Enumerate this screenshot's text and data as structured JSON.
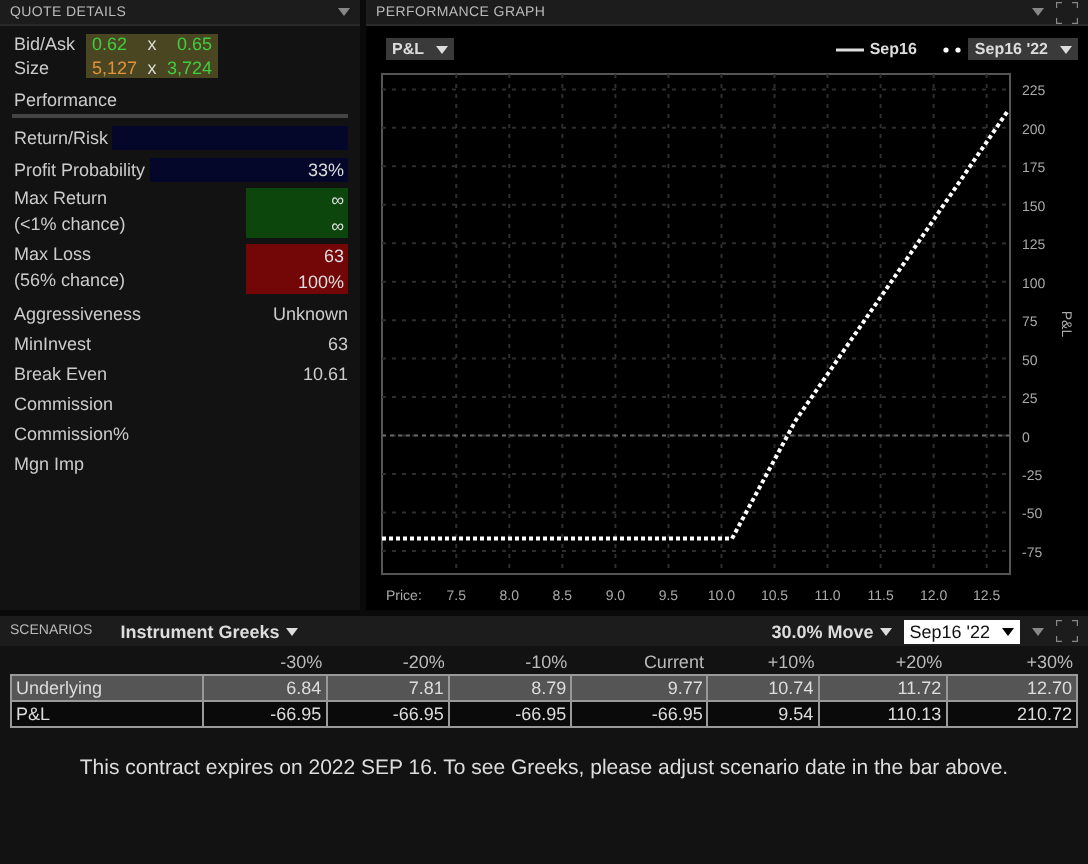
{
  "quote_details": {
    "title": "QUOTE DETAILS",
    "bid_ask": {
      "label": "Bid/Ask",
      "bid": "0.62",
      "sep": "x",
      "ask": "0.65"
    },
    "size": {
      "label": "Size",
      "bid": "5,127",
      "sep": "x",
      "ask": "3,724"
    },
    "performance_title": "Performance",
    "metrics": [
      {
        "kind": "bar",
        "label": "Return/Risk",
        "color": "#05072a"
      },
      {
        "kind": "bar",
        "label": "Profit Probability",
        "value": "33%",
        "color": "#05072a"
      },
      {
        "kind": "double",
        "label": "Max Return",
        "sublabel": "(<1% chance)",
        "value": "∞",
        "subvalue": "∞",
        "color": "#0c460c"
      },
      {
        "kind": "double",
        "label": "Max Loss",
        "sublabel": "(56% chance)",
        "value": "63",
        "subvalue": "100%",
        "color": "#730707"
      },
      {
        "kind": "plain",
        "label": "Aggressiveness",
        "value": "Unknown"
      },
      {
        "kind": "plain",
        "label": "MinInvest",
        "value": "63"
      },
      {
        "kind": "plain",
        "label": "Break Even",
        "value": "10.61"
      },
      {
        "kind": "plain",
        "label": "Commission"
      },
      {
        "kind": "plain",
        "label": "Commission%"
      },
      {
        "kind": "plain",
        "label": "Mgn Imp"
      }
    ]
  },
  "performance_graph": {
    "title": "PERFORMANCE GRAPH",
    "metric_select": "P&L",
    "legend": [
      {
        "kind": "solid",
        "label": "Sep16"
      }
    ],
    "price_label": "Price:",
    "chart_data": {
      "type": "line",
      "ylabel": "P&L",
      "x": [
        6.8,
        10.1,
        10.7,
        11.7,
        12.7
      ],
      "series": [
        {
          "name": "Sep16 '22",
          "color": "#ffffff",
          "line_style": "dotted",
          "values": [
            -67,
            -67,
            10,
            110,
            211
          ]
        }
      ],
      "xlim": [
        6.8,
        12.72
      ],
      "ylim": [
        -90,
        235
      ],
      "grid": true,
      "ref_lines": [
        {
          "axis": "y",
          "value": 0
        }
      ],
      "xticks": [
        {
          "value": 7.5,
          "label": "7.5"
        },
        {
          "value": 8,
          "label": "8.0"
        },
        {
          "value": 8.5,
          "label": "8.5"
        },
        {
          "value": 9,
          "label": "9.0"
        },
        {
          "value": 9.5,
          "label": "9.5"
        },
        {
          "value": 10,
          "label": "10.0"
        },
        {
          "value": 10.5,
          "label": "10.5"
        },
        {
          "value": 11,
          "label": "11.0"
        },
        {
          "value": 11.5,
          "label": "11.5"
        },
        {
          "value": 12,
          "label": "12.0"
        },
        {
          "value": 12.5,
          "label": "12.5"
        }
      ],
      "yticks": [
        -75,
        -50,
        -25,
        0,
        25,
        50,
        75,
        100,
        125,
        150,
        175,
        200,
        225
      ]
    }
  },
  "scenarios": {
    "title": "SCENARIOS",
    "mode_select": "Instrument Greeks",
    "move_select": "30.0% Move",
    "date_select": "Sep16 '22",
    "columns": [
      "-30%",
      "-20%",
      "-10%",
      "Current",
      "+10%",
      "+20%",
      "+30%"
    ],
    "rows": [
      {
        "label": "Underlying",
        "selected": true,
        "values": [
          "6.84",
          "7.81",
          "8.79",
          "9.77",
          "10.74",
          "11.72",
          "12.70"
        ]
      },
      {
        "label": "P&L",
        "selected": false,
        "values": [
          "-66.95",
          "-66.95",
          "-66.95",
          "-66.95",
          "9.54",
          "110.13",
          "210.72"
        ]
      }
    ],
    "message": "This contract expires on 2022 SEP 16. To see Greeks, please adjust scenario date in the bar above."
  }
}
